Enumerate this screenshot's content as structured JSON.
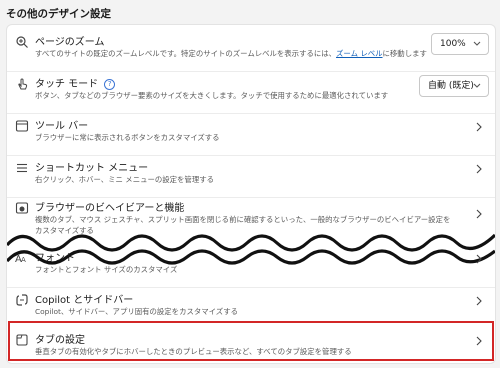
{
  "section_title": "その他のデザイン設定",
  "rows": [
    {
      "label": "ページのズーム",
      "desc_before": "すべてのサイトの既定のズームレベルです。特定のサイトのズームレベルを表示するには、",
      "desc_link": "ズーム レベル",
      "desc_after": "に移動します",
      "control_value": "100%",
      "icon": "zoom-icon"
    },
    {
      "label": "タッチ モード",
      "help": "?",
      "desc": "ボタン、タブなどのブラウザー要素のサイズを大きくします。タッチで使用するために最適化されています",
      "control_value": "自動 (既定)",
      "icon": "touch-icon"
    },
    {
      "label": "ツール バー",
      "desc": "ブラウザーに常に表示されるボタンをカスタマイズする",
      "icon": "toolbar-icon"
    },
    {
      "label": "ショートカット メニュー",
      "desc": "右クリック、ホバー、ミニ メニューの設定を管理する",
      "icon": "menu-lines-icon"
    },
    {
      "label": "ブラウザーのビヘイビアーと機能",
      "desc": "複数のタブ、マウス ジェスチャ、スプリット画面を閉じる前に確認するといった、一般的なブラウザーのビヘイビアー設定をカスタマイズする",
      "icon": "browser-behavior-icon"
    },
    {
      "label": "フォント",
      "desc": "フォントとフォント サイズのカスタマイズ",
      "icon": "font-icon"
    },
    {
      "label": "Copilot とサイドバー",
      "desc": "Copilot、サイドバー、アプリ固有の設定をカスタマイズする",
      "icon": "copilot-icon"
    },
    {
      "label": "タブの設定",
      "desc": "垂直タブの有効化やタブにホバーしたときのプレビュー表示など、すべてのタブ設定を管理する",
      "icon": "tab-icon"
    }
  ],
  "colors": {
    "highlight": "#d32626",
    "link": "#0f5eb8"
  }
}
